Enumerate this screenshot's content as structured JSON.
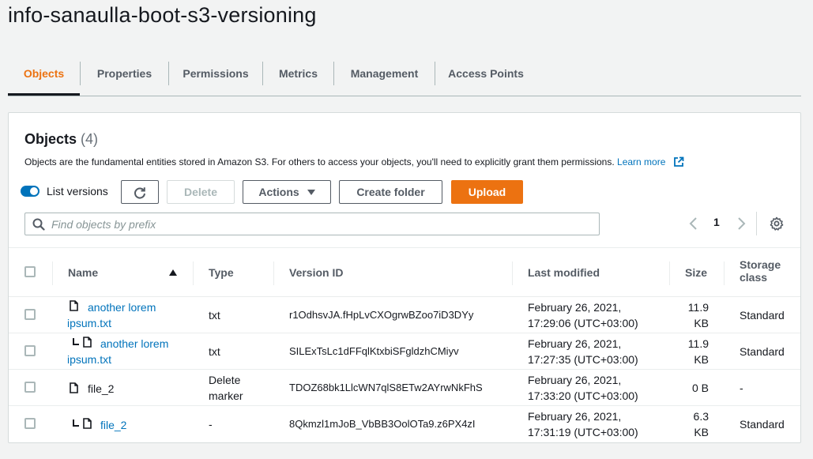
{
  "bucket": {
    "title": "info-sanaulla-boot-s3-versioning"
  },
  "tabs": [
    {
      "label": "Objects"
    },
    {
      "label": "Properties"
    },
    {
      "label": "Permissions"
    },
    {
      "label": "Metrics"
    },
    {
      "label": "Management"
    },
    {
      "label": "Access Points"
    }
  ],
  "panel": {
    "heading": "Objects",
    "count": "(4)",
    "description": "Objects are the fundamental entities stored in Amazon S3. For others to access your objects, you'll need to explicitly grant them permissions.",
    "learn_more": "Learn more"
  },
  "toolbar": {
    "list_versions_label": "List versions",
    "list_versions_on": true,
    "delete_label": "Delete",
    "actions_label": "Actions",
    "create_folder_label": "Create folder",
    "upload_label": "Upload"
  },
  "search": {
    "placeholder": "Find objects by prefix"
  },
  "pagination": {
    "current_page": "1"
  },
  "table": {
    "columns": {
      "name": "Name",
      "type": "Type",
      "version_id": "Version ID",
      "last_modified": "Last modified",
      "size": "Size",
      "storage_class_1": "Storage",
      "storage_class_2": "class"
    },
    "rows": [
      {
        "name_1": "another lorem",
        "name_2": "ipsum.txt",
        "type_1": "txt",
        "type_2": "",
        "version_id": "r1OdhsvJA.fHpLvCXOgrwBZoo7iD3DYy",
        "modified_1": "February 26, 2021,",
        "modified_2": "17:29:06 (UTC+03:00)",
        "size_1": "11.9",
        "size_2": "KB",
        "storage": "Standard"
      },
      {
        "name_1": "another lorem",
        "name_2": "ipsum.txt",
        "type_1": "txt",
        "type_2": "",
        "version_id": "SILExTsLc1dFFqlKtxbiSFgldzhCMiyv",
        "modified_1": "February 26, 2021,",
        "modified_2": "17:27:35 (UTC+03:00)",
        "size_1": "11.9",
        "size_2": "KB",
        "storage": "Standard"
      },
      {
        "name_1": "file_2",
        "name_2": "",
        "type_1": "Delete",
        "type_2": "marker",
        "version_id": "TDOZ68bk1LlcWN7qlS8ETw2AYrwNkFhS",
        "modified_1": "February 26, 2021,",
        "modified_2": "17:33:20 (UTC+03:00)",
        "size_1": "0 B",
        "size_2": "",
        "storage": "-"
      },
      {
        "name_1": "file_2",
        "name_2": "",
        "type_1": "-",
        "type_2": "",
        "version_id": "8Qkmzl1mJoB_VbBB3OolOTa9.z6PX4zI",
        "modified_1": "February 26, 2021,",
        "modified_2": "17:31:19 (UTC+03:00)",
        "size_1": "6.3",
        "size_2": "KB",
        "storage": "Standard"
      }
    ]
  },
  "colors": {
    "accent": "#ec7211",
    "link": "#0073bb",
    "toggle": "#0073bb"
  }
}
